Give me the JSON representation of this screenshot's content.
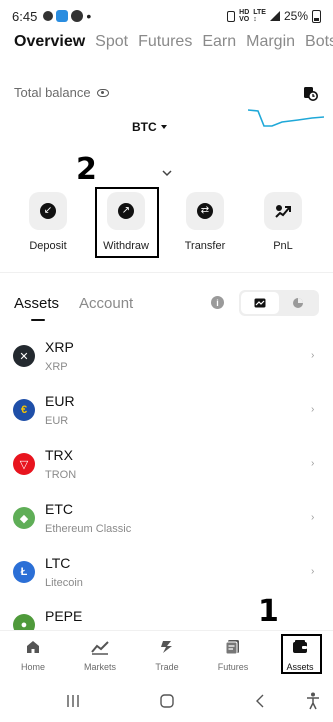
{
  "status_bar": {
    "time": "6:45",
    "battery": "25%"
  },
  "top_tabs": [
    {
      "label": "Overview",
      "active": true
    },
    {
      "label": "Spot",
      "active": false
    },
    {
      "label": "Futures",
      "active": false
    },
    {
      "label": "Earn",
      "active": false
    },
    {
      "label": "Margin",
      "active": false
    },
    {
      "label": "Bots",
      "active": false
    }
  ],
  "balance": {
    "label": "Total balance",
    "currency": "BTC"
  },
  "annotations": {
    "withdraw_marker": "2",
    "assets_marker": "1"
  },
  "quick_actions": [
    {
      "label": "Deposit",
      "icon": "deposit-icon"
    },
    {
      "label": "Withdraw",
      "icon": "withdraw-icon"
    },
    {
      "label": "Transfer",
      "icon": "transfer-icon"
    },
    {
      "label": "PnL",
      "icon": "pnl-icon"
    }
  ],
  "assets_section": {
    "tabs": [
      {
        "label": "Assets",
        "active": true
      },
      {
        "label": "Account",
        "active": false
      }
    ]
  },
  "assets": [
    {
      "symbol": "XRP",
      "name": "XRP",
      "color": "#23292f"
    },
    {
      "symbol": "EUR",
      "name": "EUR",
      "color": "#1f4fa8"
    },
    {
      "symbol": "TRX",
      "name": "TRON",
      "color": "#e8141e"
    },
    {
      "symbol": "ETC",
      "name": "Ethereum Classic",
      "color": "#5fae57"
    },
    {
      "symbol": "LTC",
      "name": "Litecoin",
      "color": "#2b6fd6"
    },
    {
      "symbol": "PEPE",
      "name": "",
      "color": "#4f9a3b"
    }
  ],
  "bottom_nav": [
    {
      "label": "Home",
      "icon": "home-icon",
      "active": false
    },
    {
      "label": "Markets",
      "icon": "markets-icon",
      "active": false
    },
    {
      "label": "Trade",
      "icon": "trade-icon",
      "active": false
    },
    {
      "label": "Futures",
      "icon": "futures-icon",
      "active": false
    },
    {
      "label": "Assets",
      "icon": "wallet-icon",
      "active": true
    }
  ]
}
